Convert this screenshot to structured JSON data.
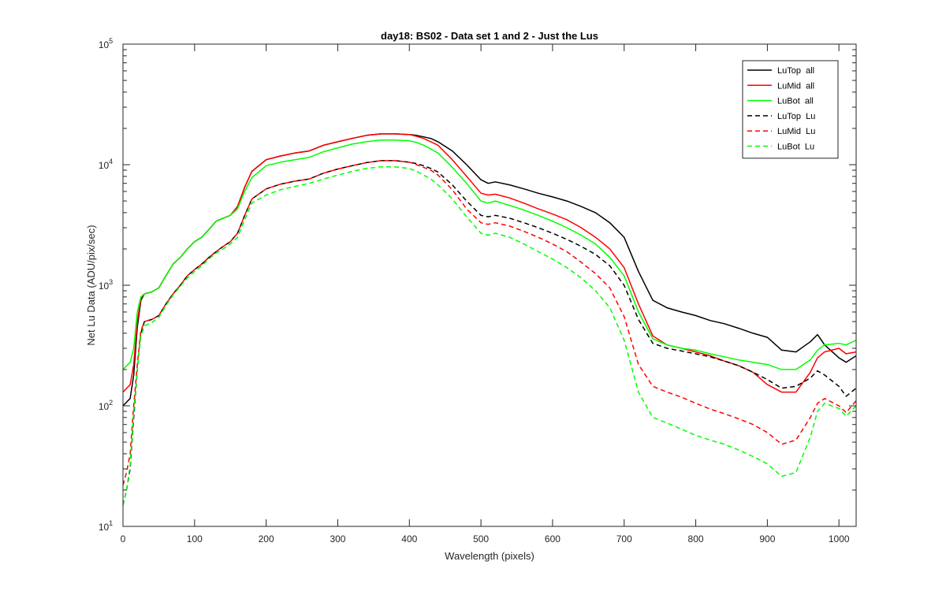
{
  "chart_data": {
    "type": "line",
    "title": "day18: BS02 - Data set 1 and 2 - Just the Lus",
    "xlabel": "Wavelength (pixels)",
    "ylabel": "Net Lu Data (ADU/pix/sec)",
    "xlim": [
      0,
      1024
    ],
    "ylim": [
      10,
      100000
    ],
    "yscale": "log",
    "grid": false,
    "legend_position": "top-right",
    "x_ticks": [
      0,
      100,
      200,
      300,
      400,
      500,
      600,
      700,
      800,
      900,
      1000
    ],
    "y_ticks": [
      {
        "value": 10,
        "base": "10",
        "exp": "1"
      },
      {
        "value": 100,
        "base": "10",
        "exp": "2"
      },
      {
        "value": 1000,
        "base": "10",
        "exp": "3"
      },
      {
        "value": 10000,
        "base": "10",
        "exp": "4"
      },
      {
        "value": 100000,
        "base": "10",
        "exp": "5"
      }
    ],
    "series": [
      {
        "name": "LuTop  all",
        "color": "#000000",
        "dash": "solid",
        "x": [
          0,
          10,
          15,
          20,
          25,
          30,
          40,
          50,
          60,
          70,
          80,
          90,
          100,
          110,
          120,
          130,
          140,
          150,
          160,
          170,
          180,
          200,
          220,
          240,
          260,
          280,
          300,
          320,
          340,
          360,
          380,
          400,
          410,
          420,
          430,
          440,
          460,
          480,
          500,
          510,
          520,
          540,
          560,
          580,
          600,
          620,
          640,
          660,
          680,
          700,
          720,
          740,
          760,
          780,
          800,
          820,
          840,
          860,
          880,
          900,
          920,
          940,
          960,
          970,
          980,
          1000,
          1010,
          1024
        ],
        "y": [
          100,
          115,
          180,
          450,
          750,
          850,
          880,
          950,
          1200,
          1500,
          1700,
          2000,
          2300,
          2500,
          2900,
          3400,
          3600,
          3800,
          4500,
          6500,
          8800,
          11000,
          11800,
          12500,
          13000,
          14500,
          15500,
          16500,
          17500,
          18000,
          18000,
          17800,
          17500,
          17000,
          16500,
          15500,
          13000,
          10000,
          7500,
          7000,
          7200,
          6800,
          6300,
          5800,
          5400,
          5000,
          4500,
          4000,
          3300,
          2500,
          1300,
          750,
          650,
          600,
          560,
          510,
          480,
          440,
          400,
          370,
          290,
          280,
          340,
          390,
          320,
          250,
          230,
          260
        ]
      },
      {
        "name": "LuMid  all",
        "color": "#ff0000",
        "dash": "solid",
        "x": [
          0,
          10,
          15,
          20,
          25,
          30,
          40,
          50,
          60,
          70,
          80,
          90,
          100,
          110,
          120,
          130,
          140,
          150,
          160,
          170,
          180,
          200,
          220,
          240,
          260,
          280,
          300,
          320,
          340,
          360,
          380,
          400,
          410,
          420,
          430,
          440,
          460,
          480,
          500,
          510,
          520,
          540,
          560,
          580,
          600,
          620,
          640,
          660,
          680,
          700,
          720,
          740,
          760,
          780,
          800,
          820,
          840,
          860,
          880,
          900,
          920,
          940,
          960,
          970,
          980,
          1000,
          1010,
          1024
        ],
        "y": [
          130,
          150,
          220,
          500,
          780,
          850,
          880,
          950,
          1200,
          1500,
          1700,
          2000,
          2300,
          2500,
          2900,
          3400,
          3600,
          3800,
          4500,
          6500,
          8800,
          11000,
          11800,
          12500,
          13000,
          14500,
          15500,
          16500,
          17500,
          18000,
          18000,
          17800,
          17200,
          16500,
          15500,
          14500,
          11000,
          8000,
          5800,
          5600,
          5700,
          5300,
          4800,
          4300,
          3900,
          3500,
          3000,
          2500,
          2000,
          1400,
          700,
          380,
          320,
          300,
          280,
          260,
          235,
          215,
          190,
          150,
          130,
          130,
          190,
          250,
          280,
          300,
          270,
          280
        ]
      },
      {
        "name": "LuBot  all",
        "color": "#00ff00",
        "dash": "solid",
        "x": [
          0,
          10,
          15,
          20,
          25,
          30,
          40,
          50,
          60,
          70,
          80,
          90,
          100,
          110,
          120,
          130,
          140,
          150,
          160,
          170,
          180,
          200,
          220,
          240,
          260,
          280,
          300,
          320,
          340,
          360,
          380,
          400,
          410,
          420,
          430,
          440,
          460,
          480,
          500,
          510,
          520,
          540,
          560,
          580,
          600,
          620,
          640,
          660,
          680,
          700,
          720,
          740,
          760,
          780,
          800,
          820,
          840,
          860,
          880,
          900,
          920,
          940,
          960,
          970,
          980,
          1000,
          1010,
          1024
        ],
        "y": [
          200,
          230,
          300,
          600,
          800,
          850,
          880,
          950,
          1200,
          1500,
          1700,
          2000,
          2300,
          2500,
          2900,
          3400,
          3600,
          3800,
          4300,
          6000,
          7800,
          9800,
          10500,
          11000,
          11500,
          12800,
          13800,
          14800,
          15500,
          16000,
          16000,
          15800,
          15300,
          14500,
          13500,
          12500,
          9500,
          7000,
          5000,
          4800,
          5000,
          4600,
          4200,
          3800,
          3400,
          3000,
          2600,
          2200,
          1700,
          1200,
          600,
          360,
          320,
          300,
          290,
          270,
          255,
          240,
          230,
          220,
          200,
          200,
          240,
          290,
          320,
          330,
          320,
          350
        ]
      },
      {
        "name": "LuTop  Lu",
        "color": "#000000",
        "dash": "dashed",
        "x": [
          0,
          5,
          10,
          15,
          20,
          25,
          30,
          40,
          50,
          60,
          70,
          80,
          90,
          100,
          110,
          120,
          130,
          140,
          150,
          160,
          170,
          180,
          200,
          220,
          240,
          260,
          280,
          300,
          320,
          340,
          360,
          380,
          400,
          410,
          420,
          430,
          440,
          460,
          480,
          500,
          510,
          520,
          540,
          560,
          580,
          600,
          620,
          640,
          660,
          680,
          700,
          720,
          740,
          760,
          780,
          800,
          820,
          840,
          860,
          880,
          900,
          920,
          940,
          960,
          970,
          980,
          1000,
          1010,
          1024
        ],
        "y": [
          15,
          20,
          30,
          80,
          200,
          400,
          500,
          520,
          560,
          700,
          850,
          1000,
          1200,
          1350,
          1500,
          1700,
          1900,
          2100,
          2300,
          2700,
          3800,
          5200,
          6300,
          6900,
          7300,
          7600,
          8500,
          9200,
          9800,
          10400,
          10800,
          10800,
          10500,
          10200,
          9800,
          9300,
          8700,
          6800,
          5000,
          3800,
          3700,
          3800,
          3600,
          3300,
          3000,
          2700,
          2400,
          2100,
          1800,
          1450,
          1000,
          520,
          330,
          300,
          285,
          270,
          255,
          235,
          215,
          190,
          165,
          140,
          145,
          170,
          195,
          180,
          145,
          120,
          140
        ]
      },
      {
        "name": "LuMid  Lu",
        "color": "#ff0000",
        "dash": "dashed",
        "x": [
          0,
          5,
          10,
          15,
          20,
          25,
          30,
          40,
          50,
          60,
          70,
          80,
          90,
          100,
          110,
          120,
          130,
          140,
          150,
          160,
          170,
          180,
          200,
          220,
          240,
          260,
          280,
          300,
          320,
          340,
          360,
          380,
          400,
          410,
          420,
          430,
          440,
          460,
          480,
          500,
          510,
          520,
          540,
          560,
          580,
          600,
          620,
          640,
          660,
          680,
          700,
          720,
          740,
          760,
          780,
          800,
          820,
          840,
          860,
          880,
          900,
          920,
          940,
          960,
          970,
          980,
          1000,
          1010,
          1024
        ],
        "y": [
          22,
          28,
          40,
          100,
          220,
          420,
          500,
          520,
          560,
          700,
          850,
          1000,
          1200,
          1350,
          1500,
          1700,
          1900,
          2100,
          2300,
          2700,
          3800,
          5200,
          6300,
          6900,
          7300,
          7600,
          8500,
          9200,
          9800,
          10400,
          10800,
          10800,
          10500,
          10000,
          9500,
          9000,
          8200,
          6200,
          4300,
          3300,
          3200,
          3300,
          3100,
          2800,
          2500,
          2200,
          1900,
          1550,
          1250,
          950,
          550,
          220,
          145,
          130,
          118,
          105,
          94,
          86,
          78,
          70,
          60,
          48,
          52,
          80,
          105,
          115,
          100,
          88,
          110
        ]
      },
      {
        "name": "LuBot  Lu",
        "color": "#00ff00",
        "dash": "dashed",
        "x": [
          0,
          5,
          10,
          15,
          20,
          25,
          30,
          40,
          50,
          60,
          70,
          80,
          90,
          100,
          110,
          120,
          130,
          140,
          150,
          160,
          170,
          180,
          200,
          220,
          240,
          260,
          280,
          300,
          320,
          340,
          360,
          380,
          400,
          410,
          420,
          430,
          440,
          460,
          480,
          500,
          510,
          520,
          540,
          560,
          580,
          600,
          620,
          640,
          660,
          680,
          700,
          720,
          740,
          760,
          780,
          800,
          820,
          840,
          860,
          880,
          900,
          920,
          940,
          960,
          970,
          980,
          1000,
          1010,
          1024
        ],
        "y": [
          15,
          20,
          32,
          90,
          200,
          380,
          460,
          490,
          540,
          680,
          830,
          980,
          1150,
          1300,
          1450,
          1650,
          1850,
          2000,
          2200,
          2500,
          3500,
          4800,
          5600,
          6200,
          6600,
          7000,
          7600,
          8200,
          8800,
          9300,
          9600,
          9600,
          9300,
          8800,
          8200,
          7600,
          6800,
          5200,
          3700,
          2700,
          2600,
          2700,
          2500,
          2200,
          1900,
          1650,
          1400,
          1150,
          900,
          650,
          350,
          130,
          80,
          72,
          64,
          57,
          52,
          48,
          43,
          38,
          33,
          26,
          28,
          55,
          90,
          105,
          95,
          82,
          100
        ]
      }
    ]
  }
}
